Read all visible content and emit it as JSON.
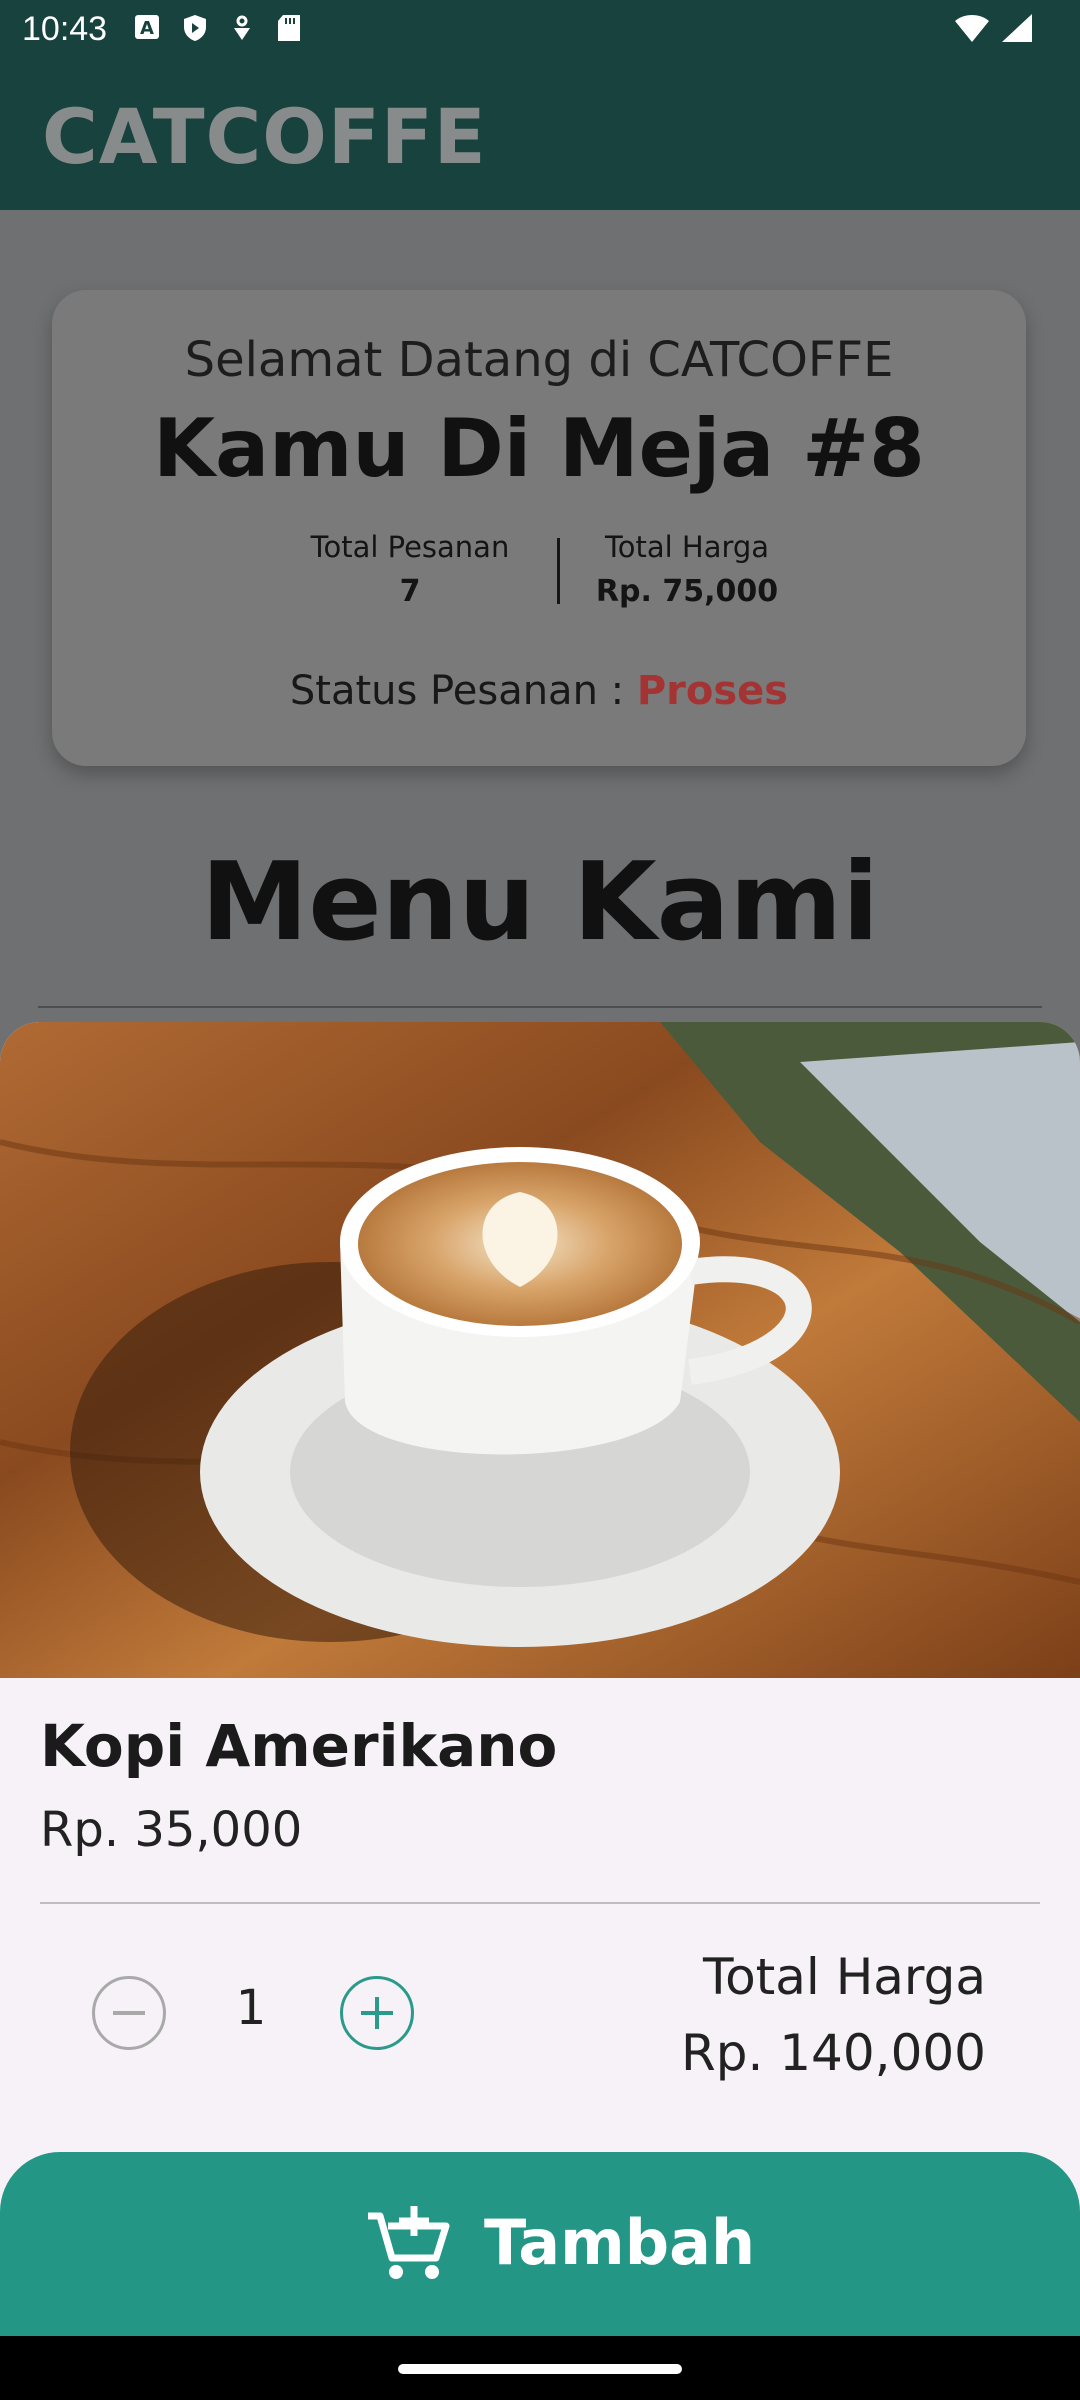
{
  "status_bar": {
    "time": "10:43",
    "icons": [
      "keyboard-a-icon",
      "shield-icon",
      "data-saver-icon",
      "sd-card-icon",
      "wifi-icon",
      "signal-icon"
    ]
  },
  "app_bar": {
    "title": "CATCOFFE"
  },
  "welcome_card": {
    "greeting": "Selamat Datang di CATCOFFE",
    "table": "Kamu Di Meja #8",
    "total_orders_label": "Total Pesanan",
    "total_orders_value": "7",
    "total_price_label": "Total Harga",
    "total_price_value": "Rp. 75,000",
    "status_label": "Status Pesanan :",
    "status_value": "Proses"
  },
  "menu": {
    "title": "Menu Kami"
  },
  "product_sheet": {
    "name": "Kopi Amerikano",
    "price": "Rp. 35,000",
    "quantity": "1",
    "total_label": "Total Harga",
    "total_value": "Rp. 140,000",
    "add_button_label": "Tambah"
  },
  "colors": {
    "app_bar": "#17423e",
    "accent": "#239685",
    "status_highlight": "#a43333",
    "scrim": "#6f7071",
    "sheet_background": "#f6f2f8"
  }
}
